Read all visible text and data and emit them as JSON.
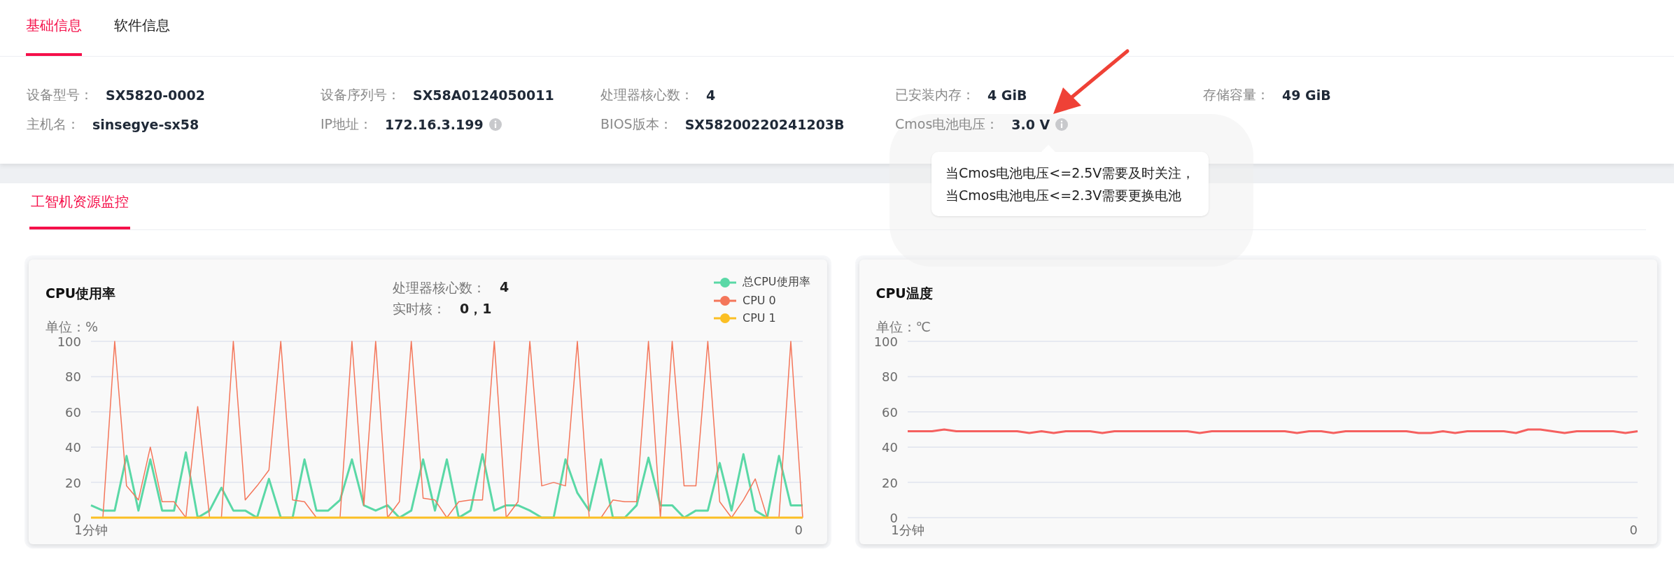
{
  "tabs": [
    {
      "label": "基础信息",
      "selected": true
    },
    {
      "label": "软件信息",
      "selected": false
    }
  ],
  "info_fields": [
    {
      "label": "设备型号：",
      "value": "SX5820-0002"
    },
    {
      "label": "设备序列号：",
      "value": "SX58A0124050011"
    },
    {
      "label": "处理器核心数：",
      "value": "4"
    },
    {
      "label": "已安装内存：",
      "value": "4 GiB"
    },
    {
      "label": "存储容量：",
      "value": "49 GiB"
    },
    {
      "label": "主机名：",
      "value": "sinsegye-sx58"
    },
    {
      "label": "IP地址：",
      "value": "172.16.3.199",
      "info_icon": true
    },
    {
      "label": "BIOS版本：",
      "value": "SX58200220241203B"
    },
    {
      "label": "Cmos电池电压：",
      "value": "3.0 V",
      "info_icon": true,
      "tooltip": [
        "当Cmos电池电压<=2.5V需要及时关注，",
        "当Cmos电池电压<=2.3V需要更换电池"
      ]
    }
  ],
  "section_tabs": [
    {
      "label": "工智机资源监控",
      "selected": true
    }
  ],
  "charts": [
    {
      "title": "CPU使用率",
      "unit": "单位：%",
      "stats": [
        {
          "label": "处理器核心数：",
          "value": "4"
        },
        {
          "label": "实时核：",
          "value": "0，1"
        }
      ],
      "x_axis_labels": [
        "1分钟",
        "0"
      ],
      "chart_data": {
        "type": "line",
        "ylim": [
          0,
          100
        ],
        "yticks": [
          0,
          20,
          40,
          60,
          80,
          100
        ],
        "grid": true,
        "series": [
          {
            "name": "总CPU使用率",
            "color": "#5ad8a6",
            "values": [
              7,
              4,
              4,
              35,
              4,
              33,
              4,
              4,
              37,
              0,
              4,
              17,
              4,
              4,
              0,
              22,
              0,
              0,
              33,
              4,
              4,
              10,
              33,
              7,
              4,
              7,
              0,
              4,
              33,
              4,
              33,
              0,
              4,
              36,
              4,
              7,
              7,
              4,
              0,
              0,
              33,
              14,
              4,
              33,
              0,
              0,
              7,
              34,
              7,
              7,
              0,
              4,
              4,
              31,
              4,
              36,
              4,
              0,
              35,
              7,
              7
            ]
          },
          {
            "name": "CPU 0",
            "color": "#f4765a",
            "values": [
              0,
              0,
              100,
              18,
              10,
              40,
              9,
              9,
              0,
              63,
              0,
              0,
              100,
              10,
              18,
              27,
              100,
              10,
              9,
              0,
              0,
              0,
              100,
              7,
              100,
              0,
              9,
              100,
              11,
              10,
              0,
              9,
              10,
              10,
              100,
              0,
              9,
              100,
              18,
              20,
              18,
              100,
              0,
              0,
              10,
              9,
              9,
              100,
              0,
              100,
              18,
              18,
              100,
              9,
              0,
              10,
              22,
              0,
              0,
              100,
              0
            ]
          },
          {
            "name": "CPU 1",
            "color": "#fbbf24",
            "values": [
              0,
              0,
              0,
              0,
              0,
              0,
              0,
              0,
              0,
              0,
              0,
              0,
              0,
              0,
              0,
              0,
              0,
              0,
              0,
              0,
              0,
              0,
              0,
              0,
              0,
              0,
              0,
              0,
              0,
              0,
              0,
              0,
              0,
              0,
              0,
              0,
              0,
              0,
              0,
              0,
              0,
              0,
              0,
              0,
              0,
              0,
              0,
              0,
              0,
              0,
              0,
              0,
              0,
              0,
              0,
              0,
              0,
              0,
              0,
              0,
              0
            ]
          }
        ]
      }
    },
    {
      "title": "CPU温度",
      "unit": "单位：℃",
      "x_axis_labels": [
        "1分钟",
        "0"
      ],
      "chart_data": {
        "type": "line",
        "ylim": [
          0,
          100
        ],
        "yticks": [
          0,
          20,
          40,
          60,
          80,
          100
        ],
        "grid": true,
        "series": [
          {
            "color": "#f5605f",
            "values": [
              49,
              49,
              49,
              50,
              49,
              49,
              49,
              49,
              49,
              49,
              48,
              49,
              48,
              49,
              49,
              49,
              48,
              49,
              49,
              49,
              49,
              49,
              49,
              49,
              48,
              49,
              49,
              49,
              49,
              49,
              49,
              49,
              48,
              49,
              49,
              48,
              49,
              49,
              49,
              49,
              49,
              49,
              48,
              48,
              49,
              48,
              49,
              49,
              49,
              49,
              48,
              50,
              50,
              49,
              48,
              49,
              49,
              49,
              49,
              48,
              49
            ]
          }
        ]
      }
    }
  ]
}
